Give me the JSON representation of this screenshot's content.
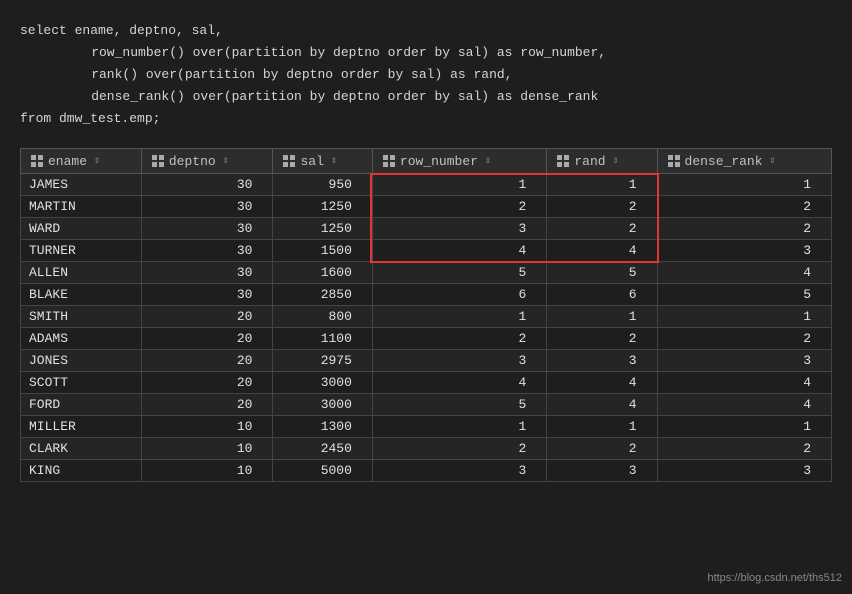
{
  "code": {
    "line1": "select ename, deptno, sal,",
    "line2": "    row_number() over(partition by deptno order by sal) as row_number,",
    "line3": "    rank() over(partition by deptno order by sal) as rand,",
    "line4": "    dense_rank() over(partition by deptno order by sal) as dense_rank",
    "line5": "from dmw_test.emp;"
  },
  "table": {
    "columns": [
      {
        "id": "ename",
        "label": "ename"
      },
      {
        "id": "deptno",
        "label": "deptno"
      },
      {
        "id": "sal",
        "label": "sal"
      },
      {
        "id": "row_number",
        "label": "row_number"
      },
      {
        "id": "rand",
        "label": "rand"
      },
      {
        "id": "dense_rank",
        "label": "dense_rank"
      }
    ],
    "rows": [
      {
        "ename": "JAMES",
        "deptno": "30",
        "sal": "950",
        "row_number": "1",
        "rand": "1",
        "dense_rank": "1"
      },
      {
        "ename": "MARTIN",
        "deptno": "30",
        "sal": "1250",
        "row_number": "2",
        "rand": "2",
        "dense_rank": "2"
      },
      {
        "ename": "WARD",
        "deptno": "30",
        "sal": "1250",
        "row_number": "3",
        "rand": "2",
        "dense_rank": "2"
      },
      {
        "ename": "TURNER",
        "deptno": "30",
        "sal": "1500",
        "row_number": "4",
        "rand": "4",
        "dense_rank": "3"
      },
      {
        "ename": "ALLEN",
        "deptno": "30",
        "sal": "1600",
        "row_number": "5",
        "rand": "5",
        "dense_rank": "4"
      },
      {
        "ename": "BLAKE",
        "deptno": "30",
        "sal": "2850",
        "row_number": "6",
        "rand": "6",
        "dense_rank": "5"
      },
      {
        "ename": "SMITH",
        "deptno": "20",
        "sal": "800",
        "row_number": "1",
        "rand": "1",
        "dense_rank": "1"
      },
      {
        "ename": "ADAMS",
        "deptno": "20",
        "sal": "1100",
        "row_number": "2",
        "rand": "2",
        "dense_rank": "2"
      },
      {
        "ename": "JONES",
        "deptno": "20",
        "sal": "2975",
        "row_number": "3",
        "rand": "3",
        "dense_rank": "3"
      },
      {
        "ename": "SCOTT",
        "deptno": "20",
        "sal": "3000",
        "row_number": "4",
        "rand": "4",
        "dense_rank": "4"
      },
      {
        "ename": "FORD",
        "deptno": "20",
        "sal": "3000",
        "row_number": "5",
        "rand": "4",
        "dense_rank": "4"
      },
      {
        "ename": "MILLER",
        "deptno": "10",
        "sal": "1300",
        "row_number": "1",
        "rand": "1",
        "dense_rank": "1"
      },
      {
        "ename": "CLARK",
        "deptno": "10",
        "sal": "2450",
        "row_number": "2",
        "rand": "2",
        "dense_rank": "2"
      },
      {
        "ename": "KING",
        "deptno": "10",
        "sal": "5000",
        "row_number": "3",
        "rand": "3",
        "dense_rank": "3"
      }
    ]
  },
  "url": "https://blog.csdn.net/ths512"
}
